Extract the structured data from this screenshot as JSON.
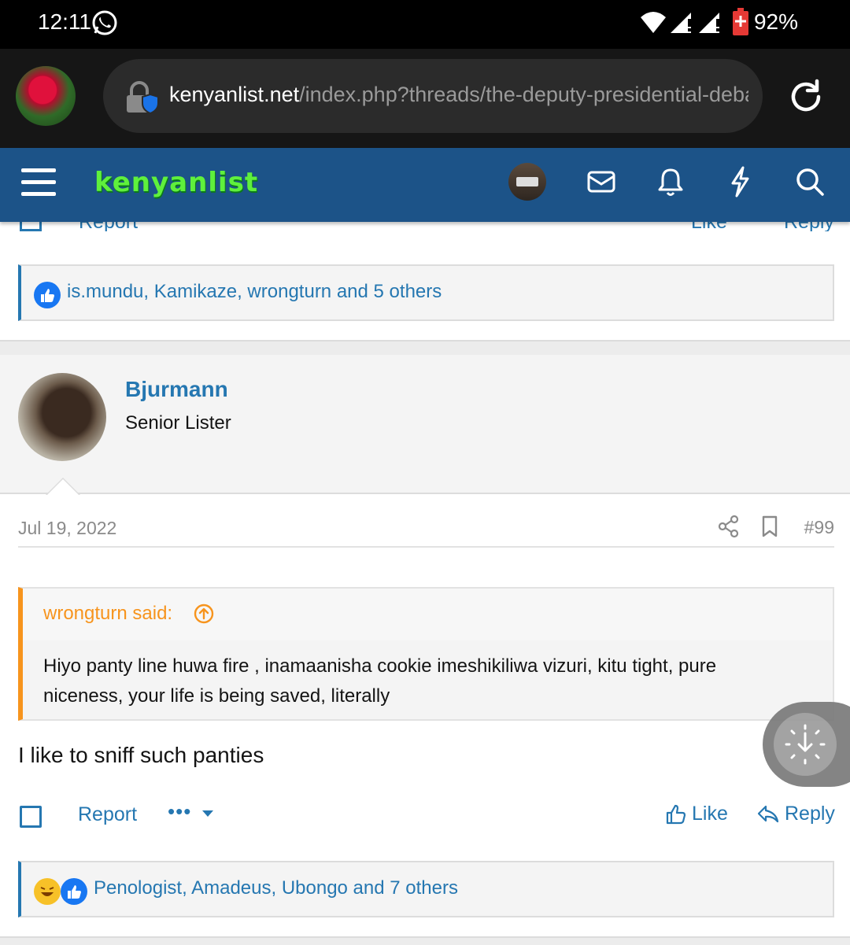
{
  "status_bar": {
    "time": "12:11",
    "battery": "92%",
    "icons": [
      "whatsapp-icon",
      "wifi-icon",
      "signal-icon",
      "signal-icon",
      "battery-icon"
    ]
  },
  "browser": {
    "url_host": "kenyanlist.net",
    "url_path": "/index.php?threads/the-deputy-presidential-debate",
    "icons": [
      "profile-avatar",
      "lock-icon",
      "reload-icon"
    ]
  },
  "site_header": {
    "logo_text": "kenyanlist",
    "icons": [
      "menu-icon",
      "user-avatar",
      "mail-icon",
      "bell-icon",
      "bolt-icon",
      "search-icon"
    ],
    "colors": {
      "header_bg": "#1c5388",
      "logo": "#5ff03c"
    }
  },
  "previous_post": {
    "reactions_text": "is.mundu, Kamikaze, wrongturn and 5 others"
  },
  "post": {
    "username": "Bjurmann",
    "user_title": "Senior Lister",
    "date": "Jul 19, 2022",
    "post_number": "#99",
    "quote": {
      "author": "wrongturn said:",
      "text": "Hiyo panty line huwa fire , inamaanisha cookie imeshikiliwa vizuri, kitu tight, pure niceness, your life is being saved, literally"
    },
    "body": "I like to sniff such panties",
    "actions": {
      "report": "Report",
      "more": "•••",
      "like": "Like",
      "reply": "Reply"
    },
    "reactions_text": "Penologist, Amadeus, Ubongo and 7 others"
  },
  "colors": {
    "link": "#2577b1",
    "quote_accent": "#f7941d",
    "like_badge": "#1877f2",
    "laugh_badge": "#f7c128"
  }
}
